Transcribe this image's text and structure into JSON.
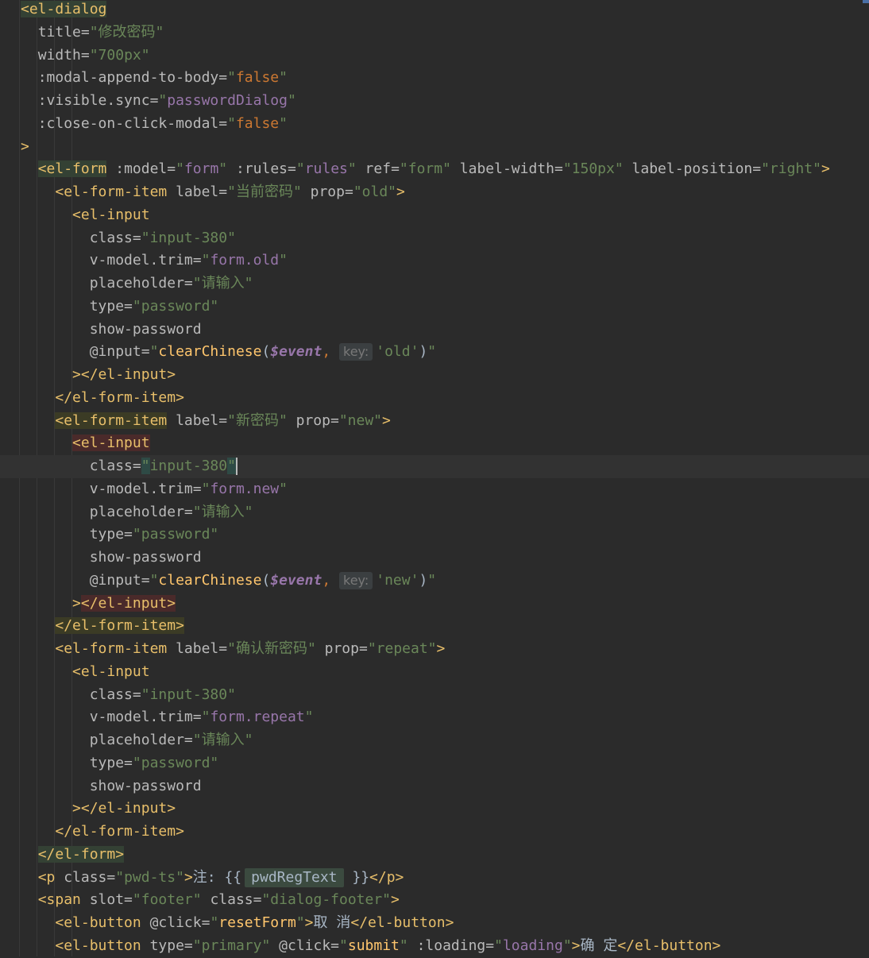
{
  "lines": [
    {
      "indent": "",
      "tokens": [
        {
          "c": "t hl-green",
          "v": "<el-dialog"
        }
      ]
    },
    {
      "indent": "  ",
      "tokens": [
        {
          "c": "a",
          "v": "title="
        },
        {
          "c": "s",
          "v": "\"修改密码\""
        }
      ]
    },
    {
      "indent": "  ",
      "tokens": [
        {
          "c": "a",
          "v": "width="
        },
        {
          "c": "s",
          "v": "\"700px\""
        }
      ]
    },
    {
      "indent": "  ",
      "tokens": [
        {
          "c": "a",
          "v": ":modal-append-to-body="
        },
        {
          "c": "s",
          "v": "\""
        },
        {
          "c": "b",
          "v": "false"
        },
        {
          "c": "s",
          "v": "\""
        }
      ]
    },
    {
      "indent": "  ",
      "tokens": [
        {
          "c": "a",
          "v": ":visible.sync="
        },
        {
          "c": "s",
          "v": "\""
        },
        {
          "c": "f",
          "v": "passwordDialog"
        },
        {
          "c": "s",
          "v": "\""
        }
      ]
    },
    {
      "indent": "  ",
      "tokens": [
        {
          "c": "a",
          "v": ":close-on-click-modal="
        },
        {
          "c": "s",
          "v": "\""
        },
        {
          "c": "b",
          "v": "false"
        },
        {
          "c": "s",
          "v": "\""
        }
      ]
    },
    {
      "indent": "",
      "tokens": [
        {
          "c": "t",
          "v": ">"
        }
      ]
    },
    {
      "indent": "  ",
      "tokens": [
        {
          "c": "t hl-green",
          "v": "<el-form"
        },
        {
          "c": "a",
          "v": " :model="
        },
        {
          "c": "s",
          "v": "\""
        },
        {
          "c": "f",
          "v": "form"
        },
        {
          "c": "s",
          "v": "\""
        },
        {
          "c": "a",
          "v": " :rules="
        },
        {
          "c": "s",
          "v": "\""
        },
        {
          "c": "f",
          "v": "rules"
        },
        {
          "c": "s",
          "v": "\""
        },
        {
          "c": "a",
          "v": " ref="
        },
        {
          "c": "s",
          "v": "\"form\""
        },
        {
          "c": "a",
          "v": " label-width="
        },
        {
          "c": "s",
          "v": "\"150px\""
        },
        {
          "c": "a",
          "v": " label-position="
        },
        {
          "c": "s",
          "v": "\"right\""
        },
        {
          "c": "t",
          "v": ">"
        }
      ]
    },
    {
      "indent": "    ",
      "tokens": [
        {
          "c": "t",
          "v": "<el-form-item"
        },
        {
          "c": "a",
          "v": " label="
        },
        {
          "c": "s",
          "v": "\"当前密码\""
        },
        {
          "c": "a",
          "v": " prop="
        },
        {
          "c": "s",
          "v": "\"old\""
        },
        {
          "c": "t",
          "v": ">"
        }
      ]
    },
    {
      "indent": "      ",
      "tokens": [
        {
          "c": "t",
          "v": "<el-input"
        }
      ]
    },
    {
      "indent": "        ",
      "tokens": [
        {
          "c": "a",
          "v": "class="
        },
        {
          "c": "s",
          "v": "\"input-380\""
        }
      ]
    },
    {
      "indent": "        ",
      "tokens": [
        {
          "c": "a",
          "v": "v-model.trim="
        },
        {
          "c": "s",
          "v": "\""
        },
        {
          "c": "f",
          "v": "form.old"
        },
        {
          "c": "s",
          "v": "\""
        }
      ]
    },
    {
      "indent": "        ",
      "tokens": [
        {
          "c": "a",
          "v": "placeholder="
        },
        {
          "c": "s",
          "v": "\"请输入\""
        }
      ]
    },
    {
      "indent": "        ",
      "tokens": [
        {
          "c": "a",
          "v": "type="
        },
        {
          "c": "s",
          "v": "\"password\""
        }
      ]
    },
    {
      "indent": "        ",
      "tokens": [
        {
          "c": "a",
          "v": "show-password"
        }
      ]
    },
    {
      "indent": "        ",
      "tokens": [
        {
          "c": "a",
          "v": "@input="
        },
        {
          "c": "s",
          "v": "\""
        },
        {
          "c": "fn",
          "v": "clearChinese"
        },
        {
          "c": "p",
          "v": "("
        },
        {
          "c": "ev",
          "v": "$event"
        },
        {
          "c": "b",
          "v": ", "
        },
        {
          "c": "hint",
          "v": "key:"
        },
        {
          "c": "s",
          "v": "'old'"
        },
        {
          "c": "p",
          "v": ")"
        },
        {
          "c": "s",
          "v": "\""
        }
      ]
    },
    {
      "indent": "      ",
      "tokens": [
        {
          "c": "t",
          "v": "></el-input>"
        }
      ]
    },
    {
      "indent": "    ",
      "tokens": [
        {
          "c": "t",
          "v": "</el-form-item>"
        }
      ]
    },
    {
      "indent": "    ",
      "tokens": [
        {
          "c": "t hl-olive",
          "v": "<el-form-item"
        },
        {
          "c": "a",
          "v": " label="
        },
        {
          "c": "s",
          "v": "\"新密码\""
        },
        {
          "c": "a",
          "v": " prop="
        },
        {
          "c": "s",
          "v": "\"new\""
        },
        {
          "c": "t",
          "v": ">"
        }
      ]
    },
    {
      "indent": "      ",
      "tokens": [
        {
          "c": "t hl-red",
          "v": "<el-input"
        }
      ]
    },
    {
      "indent": "        ",
      "current": true,
      "tokens": [
        {
          "c": "a",
          "v": "class="
        },
        {
          "c": "s hl-sel",
          "v": "\""
        },
        {
          "c": "s",
          "v": "input-380"
        },
        {
          "c": "s hl-sel",
          "v": "\""
        },
        {
          "c": "caret",
          "v": ""
        }
      ]
    },
    {
      "indent": "        ",
      "tokens": [
        {
          "c": "a",
          "v": "v-model.trim="
        },
        {
          "c": "s",
          "v": "\""
        },
        {
          "c": "f",
          "v": "form.new"
        },
        {
          "c": "s",
          "v": "\""
        }
      ]
    },
    {
      "indent": "        ",
      "tokens": [
        {
          "c": "a",
          "v": "placeholder="
        },
        {
          "c": "s",
          "v": "\"请输入\""
        }
      ]
    },
    {
      "indent": "        ",
      "tokens": [
        {
          "c": "a",
          "v": "type="
        },
        {
          "c": "s",
          "v": "\"password\""
        }
      ]
    },
    {
      "indent": "        ",
      "tokens": [
        {
          "c": "a",
          "v": "show-password"
        }
      ]
    },
    {
      "indent": "        ",
      "tokens": [
        {
          "c": "a",
          "v": "@input="
        },
        {
          "c": "s",
          "v": "\""
        },
        {
          "c": "fn",
          "v": "clearChinese"
        },
        {
          "c": "p",
          "v": "("
        },
        {
          "c": "ev",
          "v": "$event"
        },
        {
          "c": "b",
          "v": ", "
        },
        {
          "c": "hint",
          "v": "key:"
        },
        {
          "c": "s",
          "v": "'new'"
        },
        {
          "c": "p",
          "v": ")"
        },
        {
          "c": "s",
          "v": "\""
        }
      ]
    },
    {
      "indent": "      ",
      "tokens": [
        {
          "c": "t",
          "v": ">"
        },
        {
          "c": "t hl-red",
          "v": "</el-input>"
        }
      ]
    },
    {
      "indent": "    ",
      "tokens": [
        {
          "c": "t hl-olive",
          "v": "</el-form-item>"
        }
      ]
    },
    {
      "indent": "    ",
      "tokens": [
        {
          "c": "t",
          "v": "<el-form-item"
        },
        {
          "c": "a",
          "v": " label="
        },
        {
          "c": "s",
          "v": "\"确认新密码\""
        },
        {
          "c": "a",
          "v": " prop="
        },
        {
          "c": "s",
          "v": "\"repeat\""
        },
        {
          "c": "t",
          "v": ">"
        }
      ]
    },
    {
      "indent": "      ",
      "tokens": [
        {
          "c": "t",
          "v": "<el-input"
        }
      ]
    },
    {
      "indent": "        ",
      "tokens": [
        {
          "c": "a",
          "v": "class="
        },
        {
          "c": "s",
          "v": "\"input-380\""
        }
      ]
    },
    {
      "indent": "        ",
      "tokens": [
        {
          "c": "a",
          "v": "v-model.trim="
        },
        {
          "c": "s",
          "v": "\""
        },
        {
          "c": "f",
          "v": "form.repeat"
        },
        {
          "c": "s",
          "v": "\""
        }
      ]
    },
    {
      "indent": "        ",
      "tokens": [
        {
          "c": "a",
          "v": "placeholder="
        },
        {
          "c": "s",
          "v": "\"请输入\""
        }
      ]
    },
    {
      "indent": "        ",
      "tokens": [
        {
          "c": "a",
          "v": "type="
        },
        {
          "c": "s",
          "v": "\"password\""
        }
      ]
    },
    {
      "indent": "        ",
      "tokens": [
        {
          "c": "a",
          "v": "show-password"
        }
      ]
    },
    {
      "indent": "      ",
      "tokens": [
        {
          "c": "t",
          "v": "></el-input>"
        }
      ]
    },
    {
      "indent": "    ",
      "tokens": [
        {
          "c": "t",
          "v": "</el-form-item>"
        }
      ]
    },
    {
      "indent": "  ",
      "tokens": [
        {
          "c": "t hl-green",
          "v": "</el-form>"
        }
      ]
    },
    {
      "indent": "  ",
      "tokens": [
        {
          "c": "t",
          "v": "<p"
        },
        {
          "c": "a",
          "v": " class="
        },
        {
          "c": "s",
          "v": "\"pwd-ts\""
        },
        {
          "c": "t",
          "v": ">"
        },
        {
          "c": "p",
          "v": "注: {{"
        },
        {
          "c": "interp",
          "v": "pwdRegText"
        },
        {
          "c": "p",
          "v": " }}"
        },
        {
          "c": "t",
          "v": "</p>"
        }
      ]
    },
    {
      "indent": "  ",
      "tokens": [
        {
          "c": "t",
          "v": "<span"
        },
        {
          "c": "a",
          "v": " slot="
        },
        {
          "c": "s",
          "v": "\"footer\""
        },
        {
          "c": "a",
          "v": " class="
        },
        {
          "c": "s",
          "v": "\"dialog-footer\""
        },
        {
          "c": "t",
          "v": ">"
        }
      ]
    },
    {
      "indent": "    ",
      "tokens": [
        {
          "c": "t",
          "v": "<el-button"
        },
        {
          "c": "a",
          "v": " @click="
        },
        {
          "c": "s",
          "v": "\""
        },
        {
          "c": "fn",
          "v": "resetForm"
        },
        {
          "c": "s",
          "v": "\""
        },
        {
          "c": "t",
          "v": ">"
        },
        {
          "c": "p",
          "v": "取 消"
        },
        {
          "c": "t",
          "v": "</el-button>"
        }
      ]
    },
    {
      "indent": "    ",
      "tokens": [
        {
          "c": "t",
          "v": "<el-button"
        },
        {
          "c": "a",
          "v": " type="
        },
        {
          "c": "s",
          "v": "\"primary\""
        },
        {
          "c": "a",
          "v": " @click="
        },
        {
          "c": "s",
          "v": "\""
        },
        {
          "c": "fn",
          "v": "submit"
        },
        {
          "c": "s",
          "v": "\""
        },
        {
          "c": "a",
          "v": " :loading="
        },
        {
          "c": "s",
          "v": "\""
        },
        {
          "c": "f",
          "v": "loading"
        },
        {
          "c": "s",
          "v": "\""
        },
        {
          "c": "t",
          "v": ">"
        },
        {
          "c": "p",
          "v": "确 定"
        },
        {
          "c": "t",
          "v": "</el-button>"
        }
      ]
    }
  ]
}
